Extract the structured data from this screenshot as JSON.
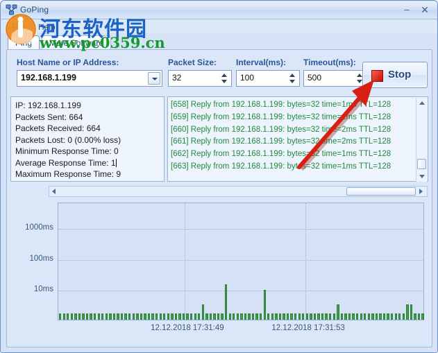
{
  "window": {
    "title": "GoPing",
    "icon": "network-icon",
    "minimize_label": "–",
    "close_label": "✕"
  },
  "menu": {
    "items": [
      {
        "label": "File",
        "name": "menu-file"
      },
      {
        "label": "Help",
        "name": "menu-help"
      }
    ]
  },
  "tabs": [
    {
      "label": "Ping",
      "selected": true
    },
    {
      "label": "More Software",
      "selected": false
    }
  ],
  "form": {
    "host": {
      "label": "Host Name or IP Address:",
      "value": "192.168.1.199"
    },
    "packet_size": {
      "label": "Packet Size:",
      "value": "32"
    },
    "interval": {
      "label": "Interval(ms):",
      "value": "100"
    },
    "timeout": {
      "label": "Timeout(ms):",
      "value": "500"
    },
    "stop_button": {
      "label": "Stop",
      "icon": "stop-square-icon",
      "color": "#c71208"
    }
  },
  "stats": {
    "ip": "IP: 192.168.1.199",
    "packets_sent": "Packets Sent: 664",
    "packets_received": "Packets Received: 664",
    "packets_lost": "Packets Lost: 0 (0.00% loss)",
    "min_response": "Minimum Response Time: 0",
    "avg_response": "Average Response Time: 1",
    "max_response": "Maximum Response Time: 9"
  },
  "log": {
    "color": "#1f8a3c",
    "lines": [
      "[658] Reply from 192.168.1.199: bytes=32 time=1ms TTL=128",
      "[659] Reply from 192.168.1.199: bytes=32 time=1ms TTL=128",
      "[660] Reply from 192.168.1.199: bytes=32 time=2ms TTL=128",
      "[661] Reply from 192.168.1.199: bytes=32 time=2ms TTL=128",
      "[662] Reply from 192.168.1.199: bytes=32 time=1ms TTL=128",
      "[663] Reply from 192.168.1.199: bytes=32 time=1ms TTL=128"
    ]
  },
  "watermark": {
    "chinese": "河东软件园",
    "url": "www.pc0359.cn",
    "logo": "circle-badge-icon"
  },
  "annotation": {
    "arrow": "red-arrow-pointing-to-stop-button",
    "color": "#d81f12"
  },
  "chart_data": {
    "type": "bar",
    "title": "",
    "xlabel": "",
    "ylabel": "",
    "y_scale": "log",
    "y_ticks": [
      "1000ms",
      "100ms",
      "10ms"
    ],
    "y_tick_positions": [
      0.78,
      0.52,
      0.26
    ],
    "x_tick_labels": [
      "12.12.2018 17:31:49",
      "12.12.2018 17:31:53"
    ],
    "x_tick_positions": [
      0.345,
      0.675
    ],
    "grid": true,
    "legend": "none",
    "bar_color": "#3f9d48",
    "unit": "ms",
    "values": [
      1,
      1,
      1,
      1,
      1,
      1,
      1,
      1,
      1,
      1,
      1,
      1,
      1,
      1,
      1,
      1,
      1,
      1,
      1,
      1,
      1,
      1,
      1,
      1,
      1,
      1,
      1,
      1,
      1,
      1,
      1,
      1,
      1,
      1,
      1,
      1,
      1,
      2,
      1,
      1,
      1,
      1,
      1,
      9,
      1,
      1,
      1,
      1,
      1,
      1,
      1,
      1,
      1,
      6,
      1,
      1,
      1,
      1,
      1,
      1,
      1,
      1,
      1,
      1,
      1,
      1,
      1,
      1,
      1,
      1,
      1,
      1,
      2,
      1,
      1,
      1,
      1,
      1,
      1,
      1,
      1,
      1,
      1,
      1,
      1,
      1,
      1,
      1,
      1,
      1,
      2,
      2,
      1,
      1,
      1
    ]
  }
}
